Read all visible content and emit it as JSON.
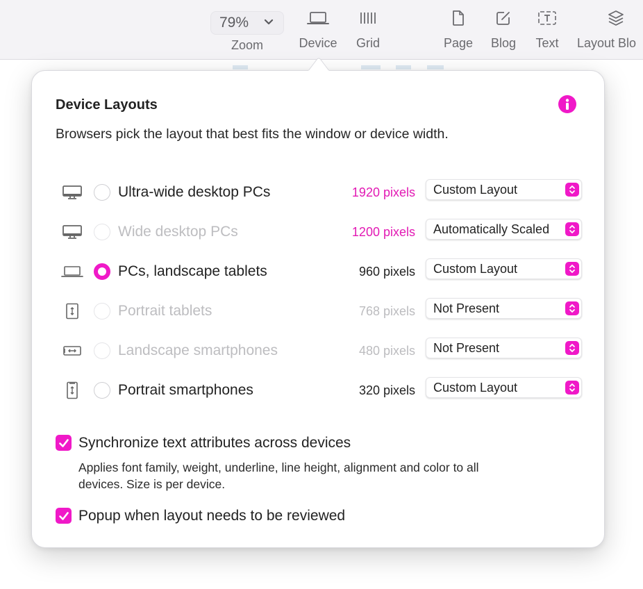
{
  "toolbar": {
    "zoom": {
      "value": "79%",
      "label": "Zoom",
      "icon": "chevron-down-icon"
    },
    "items": [
      {
        "label": "Device",
        "icon": "laptop-icon"
      },
      {
        "label": "Grid",
        "icon": "grid-lines-icon"
      },
      {
        "label": "Page",
        "icon": "page-icon"
      },
      {
        "label": "Blog",
        "icon": "blog-edit-icon"
      },
      {
        "label": "Text",
        "icon": "text-box-icon"
      },
      {
        "label": "Layout Blo",
        "icon": "layers-icon"
      }
    ]
  },
  "popover": {
    "title": "Device Layouts",
    "subtitle": "Browsers pick the layout that best fits the window or device width.",
    "info_icon": "info-icon",
    "accent_color": "#f019c8",
    "devices": [
      {
        "icon": "desktop-icon",
        "label": "Ultra-wide desktop PCs",
        "pixels": "1920 pixels",
        "layout": "Custom Layout",
        "selected": false,
        "enabled": true,
        "pixel_style": "accent"
      },
      {
        "icon": "desktop-icon",
        "label": "Wide desktop PCs",
        "pixels": "1200 pixels",
        "layout": "Automatically Scaled",
        "selected": false,
        "enabled": false,
        "pixel_style": "accent"
      },
      {
        "icon": "laptop-icon",
        "label": "PCs, landscape tablets",
        "pixels": "960 pixels",
        "layout": "Custom Layout",
        "selected": true,
        "enabled": true,
        "pixel_style": "normal"
      },
      {
        "icon": "tablet-portrait-icon",
        "label": "Portrait tablets",
        "pixels": "768 pixels",
        "layout": "Not Present",
        "selected": false,
        "enabled": false,
        "pixel_style": "dim"
      },
      {
        "icon": "phone-landscape-icon",
        "label": "Landscape smartphones",
        "pixels": "480 pixels",
        "layout": "Not Present",
        "selected": false,
        "enabled": false,
        "pixel_style": "dim"
      },
      {
        "icon": "phone-portrait-icon",
        "label": "Portrait smartphones",
        "pixels": "320 pixels",
        "layout": "Custom Layout",
        "selected": false,
        "enabled": true,
        "pixel_style": "normal"
      }
    ],
    "sync_text": {
      "checked": true,
      "label": "Synchronize text attributes across devices",
      "description": "Applies font family, weight, underline, line height, alignment and color to all devices. Size is per device."
    },
    "popup_review": {
      "checked": true,
      "label": "Popup when layout needs to be reviewed"
    }
  }
}
